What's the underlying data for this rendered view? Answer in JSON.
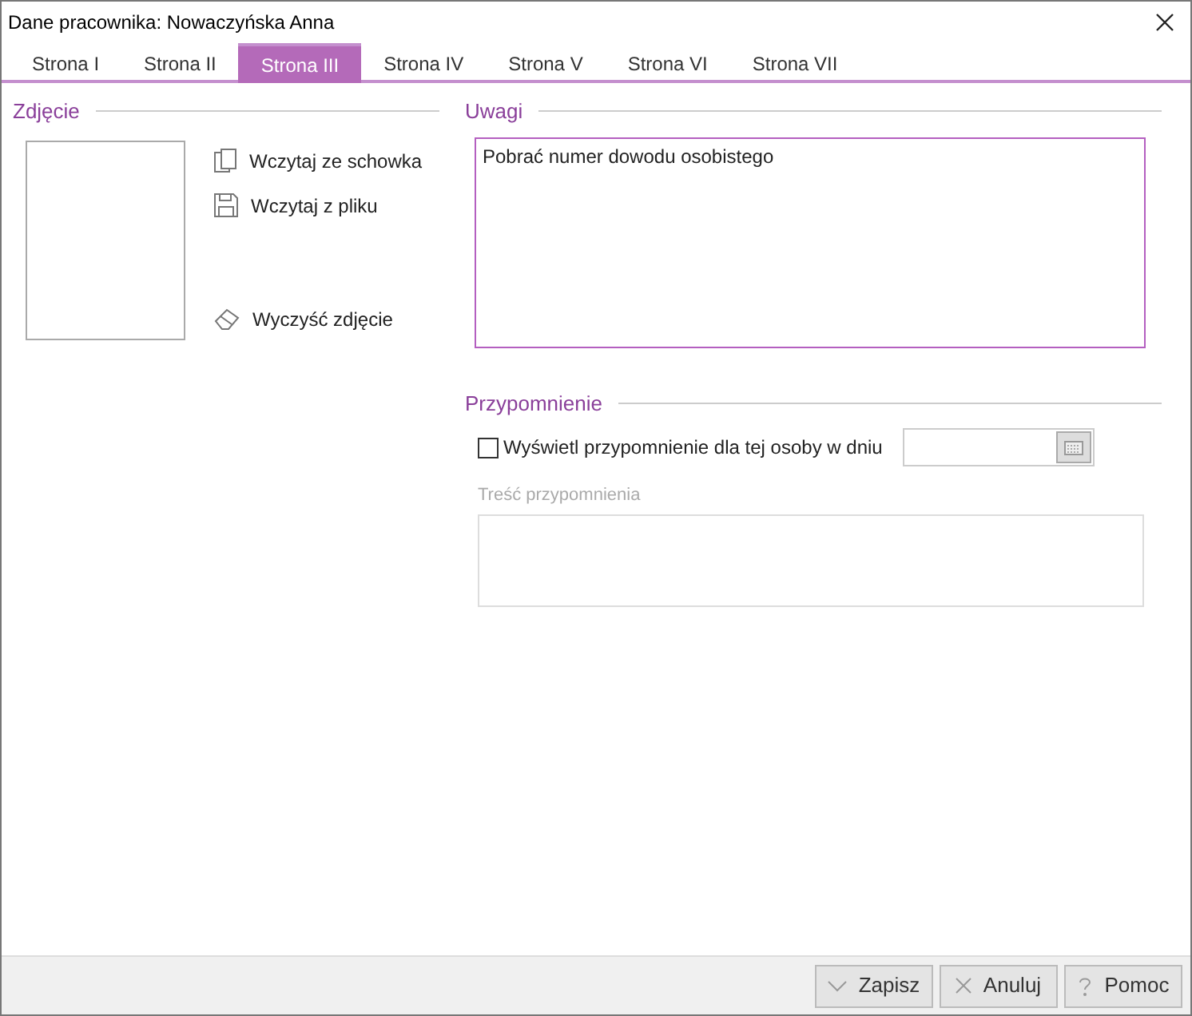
{
  "window": {
    "title": "Dane pracownika: Nowaczyńska Anna"
  },
  "tabs": [
    {
      "label": "Strona I",
      "selected": false
    },
    {
      "label": "Strona II",
      "selected": false
    },
    {
      "label": "Strona III",
      "selected": true
    },
    {
      "label": "Strona IV",
      "selected": false
    },
    {
      "label": "Strona V",
      "selected": false
    },
    {
      "label": "Strona VI",
      "selected": false
    },
    {
      "label": "Strona VII",
      "selected": false
    }
  ],
  "photo": {
    "title": "Zdjęcie",
    "actions": [
      {
        "kind": "paste",
        "label": "Wczytaj ze schowka"
      },
      {
        "kind": "file",
        "label": "Wczytaj z pliku"
      },
      {
        "kind": "clear",
        "label": "Wyczyść zdjęcie"
      }
    ]
  },
  "notes": {
    "title": "Uwagi",
    "value": "Pobrać numer dowodu osobistego"
  },
  "reminder": {
    "title": "Przypomnienie",
    "checkbox": {
      "label": "Wyświetl przypomnienie dla tej osoby w dniu",
      "checked": false
    },
    "content_label": "Treść przypomnienia"
  },
  "buttons": [
    {
      "kind": "save",
      "label": "Zapisz"
    },
    {
      "kind": "cancel",
      "label": "Anuluj"
    },
    {
      "kind": "help",
      "label": "Pomoc"
    }
  ]
}
